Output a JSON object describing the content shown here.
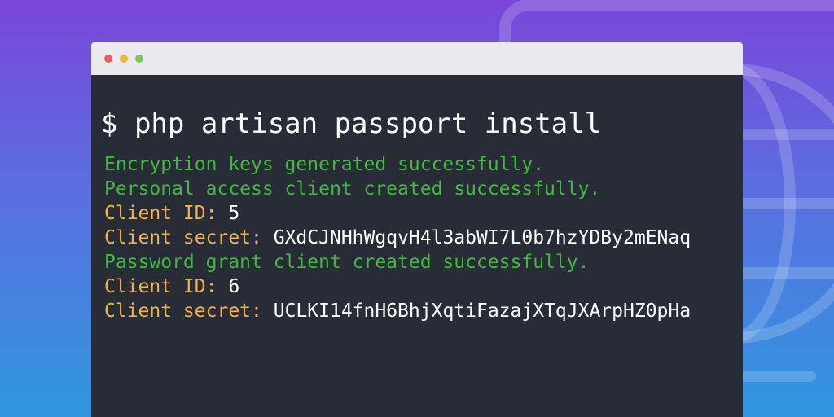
{
  "colors": {
    "background_top": "#7a45d9",
    "background_bottom": "#2f97e0",
    "terminal_bg": "#282c37",
    "titlebar_bg": "#ebeaef",
    "success_green": "#41b83f",
    "label_yellow": "#f0b34a",
    "value_white": "#ffffff",
    "dot_red": "#ee5b55",
    "dot_yellow": "#f1b53a",
    "dot_green": "#7ac95b"
  },
  "icons": {
    "background": "globe-window-icon"
  },
  "terminal": {
    "command": "$ php artisan passport install",
    "lines": [
      {
        "type": "success",
        "text": "Encryption keys generated successfully."
      },
      {
        "type": "success",
        "text": "Personal access client created successfully."
      },
      {
        "type": "kv",
        "label": "Client ID:",
        "value": "5"
      },
      {
        "type": "kv",
        "label": "Client secret:",
        "value": "GXdCJNHhWgqvH4l3abWI7L0b7hzYDBy2mENaq"
      },
      {
        "type": "success",
        "text": "Password grant client created successfully."
      },
      {
        "type": "kv",
        "label": "Client ID:",
        "value": "6"
      },
      {
        "type": "kv",
        "label": "Client secret:",
        "value": "UCLKI14fnH6BhjXqtiFazajXTqJXArpHZ0pHa"
      }
    ]
  }
}
